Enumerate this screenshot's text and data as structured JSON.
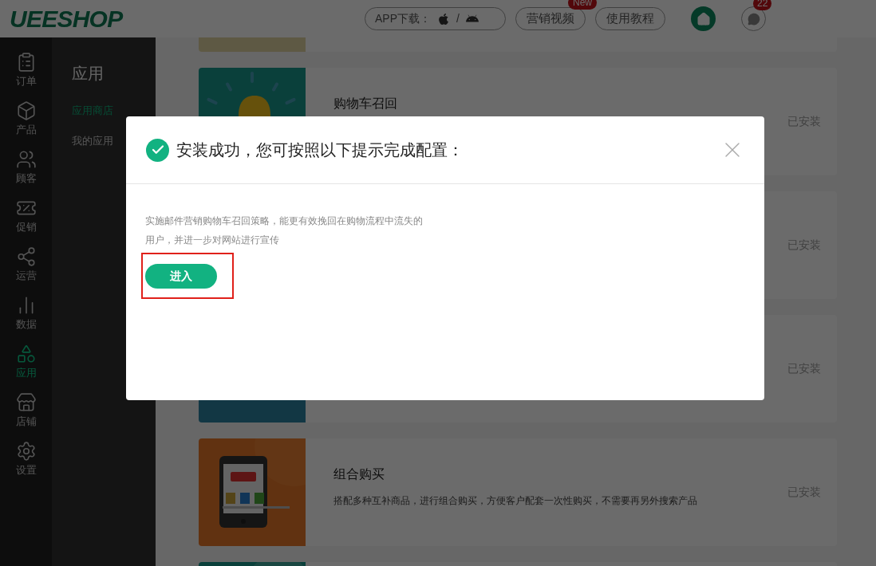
{
  "header": {
    "logo": "UEESHOP",
    "app_download": "APP下载：",
    "separator": "/",
    "buttons": [
      {
        "label": "营销视频",
        "badge": "New"
      },
      {
        "label": "使用教程"
      }
    ],
    "message_count": "22"
  },
  "sidebar": {
    "items": [
      {
        "label": "订单",
        "selected": false
      },
      {
        "label": "产品",
        "selected": false
      },
      {
        "label": "顾客",
        "selected": false
      },
      {
        "label": "促销",
        "selected": false
      },
      {
        "label": "运营",
        "selected": false
      },
      {
        "label": "数据",
        "selected": false
      },
      {
        "label": "应用",
        "selected": true
      },
      {
        "label": "店铺",
        "selected": false
      },
      {
        "label": "设置",
        "selected": false
      }
    ]
  },
  "submenu": {
    "title": "应用",
    "items": [
      {
        "label": "应用商店",
        "selected": true
      },
      {
        "label": "我的应用",
        "selected": false
      }
    ]
  },
  "cards": [
    {
      "kind": "picture"
    },
    {
      "kind": "picture",
      "title": "购物车召回",
      "status": "已安装"
    },
    {
      "status": "已安装"
    },
    {
      "kind": "picture",
      "status": "已安装"
    },
    {
      "kind": "picture",
      "title": "组合购买",
      "description": "搭配多种互补商品，进行组合购买，方便客户配套一次性购买，不需要再另外搜索产品",
      "status": "已安装"
    },
    {
      "kind": "picture"
    }
  ],
  "dialog": {
    "title": "安装成功，您可按照以下提示完成配置：",
    "message": "实施邮件营销购物车召回策略，能更有效挽回在购物流程中流失的用户，并进一步对网站进行宣传",
    "button": {
      "label": "进入",
      "highlighted": true
    }
  }
}
